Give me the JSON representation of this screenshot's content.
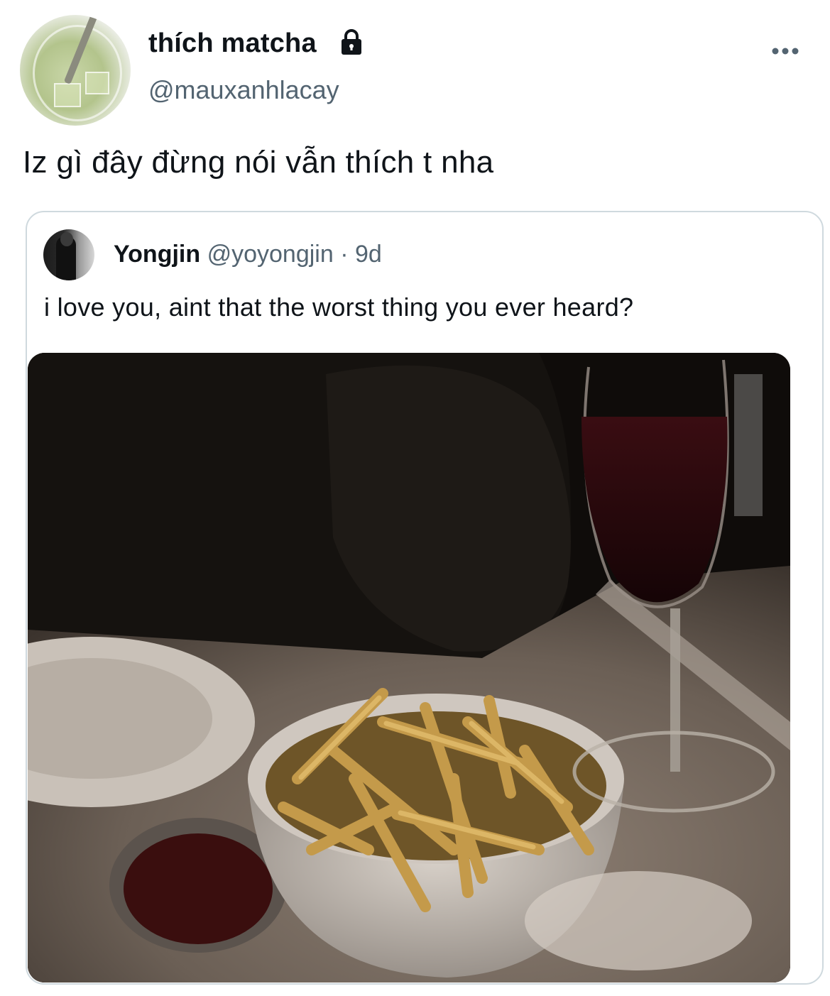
{
  "author": {
    "display_name": "thích matcha",
    "handle": "@mauxanhlacay",
    "protected_icon": "lock-icon",
    "avatar_icon": "matcha-drink-avatar"
  },
  "more_menu_icon": "ellipsis-icon",
  "tweet": {
    "text": "Iz gì đây đừng nói vẫn thích t nha"
  },
  "quoted_tweet": {
    "display_name": "Yongjin",
    "handle": "@yoyongjin",
    "separator": "·",
    "time": "9d",
    "text": "i love you, aint that the worst thing you ever heard?",
    "media_icon": "photo-fries-and-wine"
  },
  "colors": {
    "text_primary": "#0f1419",
    "text_secondary": "#536471",
    "border": "#cfd9de"
  }
}
